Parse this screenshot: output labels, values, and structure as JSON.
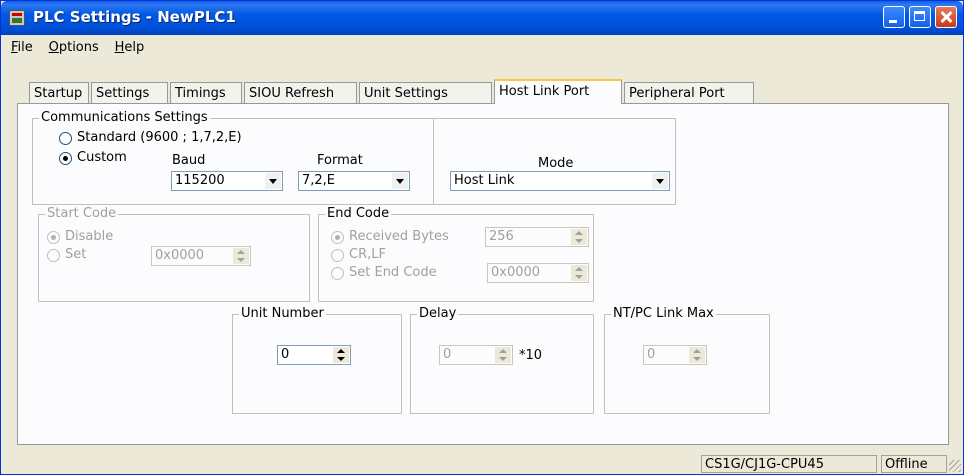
{
  "window": {
    "title": "PLC Settings - NewPLC1"
  },
  "menu": [
    {
      "first": "F",
      "rest": "ile"
    },
    {
      "first": "O",
      "rest": "ptions"
    },
    {
      "first": "H",
      "rest": "elp"
    }
  ],
  "tabs": [
    "Startup",
    "Settings",
    "Timings",
    "SIOU Refresh",
    "Unit Settings",
    "Host Link Port",
    "Peripheral Port"
  ],
  "active_tab": "Host Link Port",
  "comm": {
    "title": "Communications Settings",
    "standard_label": "Standard (9600 ; 1,7,2,E)",
    "custom_label": "Custom",
    "selected": "Custom",
    "baud_label": "Baud",
    "baud_value": "115200",
    "format_label": "Format",
    "format_value": "7,2,E",
    "mode_label": "Mode",
    "mode_value": "Host Link"
  },
  "start_code": {
    "title": "Start Code",
    "disable_label": "Disable",
    "set_label": "Set",
    "selected": "Disable",
    "set_value": "0x0000"
  },
  "end_code": {
    "title": "End Code",
    "received_label": "Received Bytes",
    "received_value": "256",
    "crlf_label": "CR,LF",
    "set_end_label": "Set End Code",
    "set_end_value": "0x0000",
    "selected": "Received Bytes"
  },
  "unit_number": {
    "title": "Unit Number",
    "value": "0"
  },
  "delay": {
    "title": "Delay",
    "value": "0",
    "unit": "*10"
  },
  "ntpc": {
    "title": "NT/PC Link Max",
    "value": "0"
  },
  "status": {
    "cpu": "CS1G/CJ1G-CPU45",
    "mode": "Offline"
  }
}
